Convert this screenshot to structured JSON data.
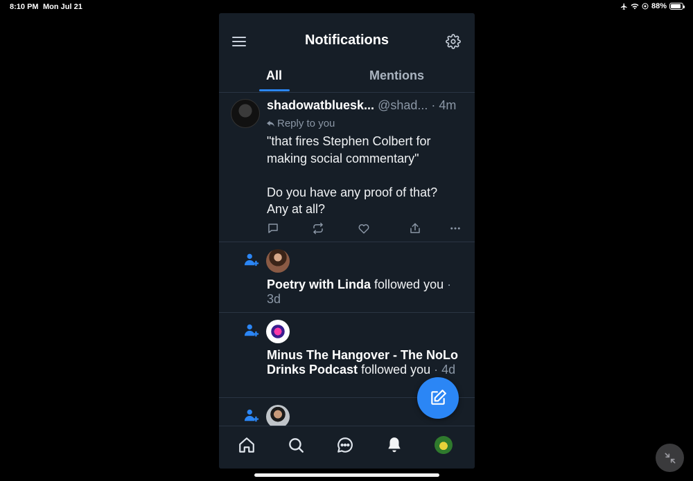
{
  "status_bar": {
    "time": "8:10 PM",
    "date": "Mon Jul 21",
    "battery": "88%",
    "battery_level": 0.88
  },
  "header": {
    "title": "Notifications",
    "menu_icon": "hamburger-icon",
    "settings_icon": "gear-icon"
  },
  "tabs": [
    {
      "label": "All",
      "active": true
    },
    {
      "label": "Mentions",
      "active": false
    }
  ],
  "post": {
    "display_name": "shadowatbluesk...",
    "handle": "@shad...",
    "time": "· 4m",
    "reply_label": "Reply to you",
    "text_lines": [
      "\"that fires Stephen Colbert for making social commentary\"",
      "Do you have any proof of that? Any at all?"
    ],
    "actions": [
      "reply-icon",
      "repost-icon",
      "like-icon",
      "share-icon",
      "more-icon"
    ]
  },
  "notifications": [
    {
      "name": "Poetry with Linda",
      "action": "followed you",
      "time": "· 3d"
    },
    {
      "name": "Minus The Hangover - The NoLo Drinks Podcast",
      "action": "followed you",
      "time": "· 4d"
    },
    {
      "name": "",
      "action": "",
      "time": ""
    }
  ],
  "bottom_nav": [
    "home-icon",
    "search-icon",
    "chat-icon",
    "bell-icon",
    "profile-avatar"
  ],
  "colors": {
    "background": "#161e27",
    "accent": "#2b86f5",
    "muted_text": "#8b97a6"
  }
}
